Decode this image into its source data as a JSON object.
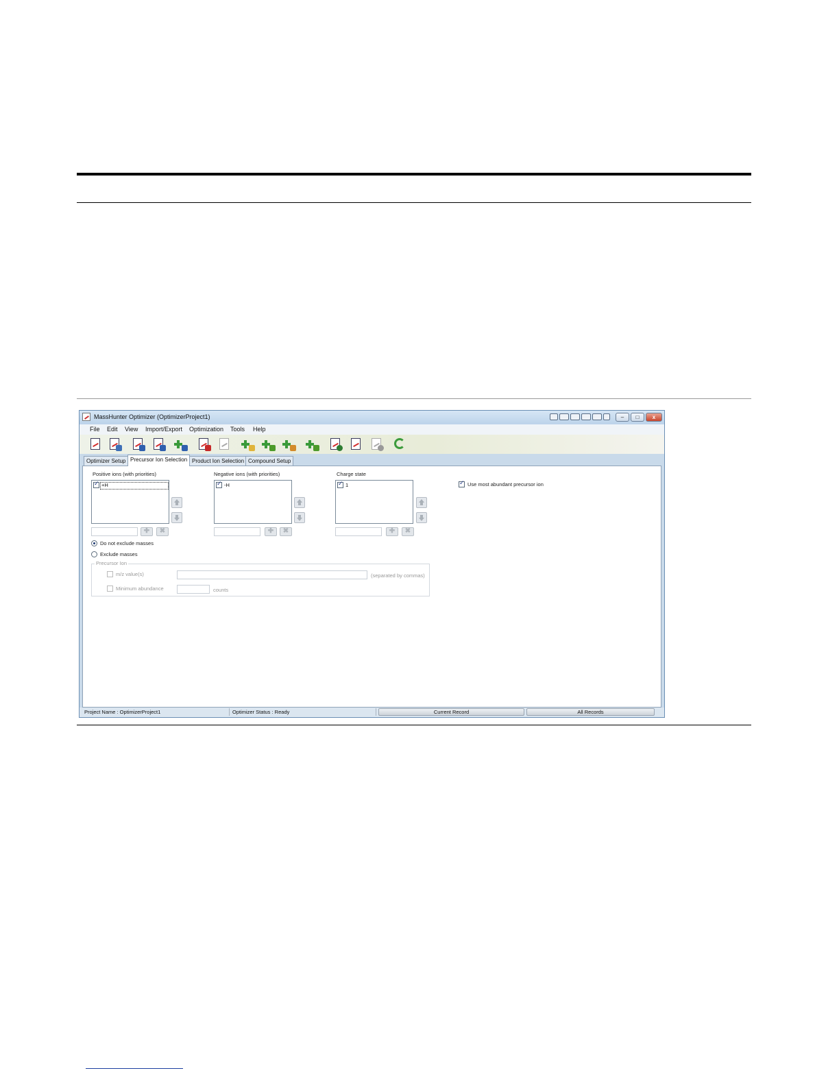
{
  "window": {
    "title": "MassHunter Optimizer (OptimizerProject1)",
    "min_glyph": "–",
    "max_glyph": "□",
    "close_glyph": "x"
  },
  "menu": [
    "File",
    "Edit",
    "View",
    "Import/Export",
    "Optimization",
    "Tools",
    "Help"
  ],
  "toolbar_icons": [
    "method-icon",
    "open-icon",
    "save-icon",
    "save-as-icon",
    "add-save-icon",
    "delete-icon",
    "copy-icon",
    "add-list-icon",
    "add-method-icon",
    "add-table-icon",
    "add-m-icon",
    "run-icon",
    "chromatogram-icon",
    "stop-icon",
    "refresh-icon"
  ],
  "tabs": [
    {
      "label": "Optimizer Setup"
    },
    {
      "label": "Precursor Ion Selection"
    },
    {
      "label": "Product Ion Selection"
    },
    {
      "label": "Compound Setup"
    }
  ],
  "precursor": {
    "positive_label": "Positive ions  (with priorities)",
    "positive_items": [
      "+H"
    ],
    "negative_label": "Negative ions (with priorities)",
    "negative_items": [
      "-H"
    ],
    "charge_label": "Charge state",
    "charge_items": [
      "1"
    ],
    "plus_glyph": "✚",
    "remove_glyph": "✖",
    "use_most_abundant": "Use most abundant precursor ion",
    "radio_no_exclude": "Do not exclude masses",
    "radio_exclude": "Exclude masses",
    "group_title": "Precursor Ion",
    "mz_label": "m/z value(s)",
    "mz_hint": "(separated by commas)",
    "min_abundance_label": "Minimum abundance",
    "counts_label": "counts"
  },
  "status": {
    "project": "Project Name : OptimizerProject1",
    "optimizer_status": "Optimizer Status : Ready",
    "current_record": "Current Record",
    "all_records": "All Records"
  }
}
